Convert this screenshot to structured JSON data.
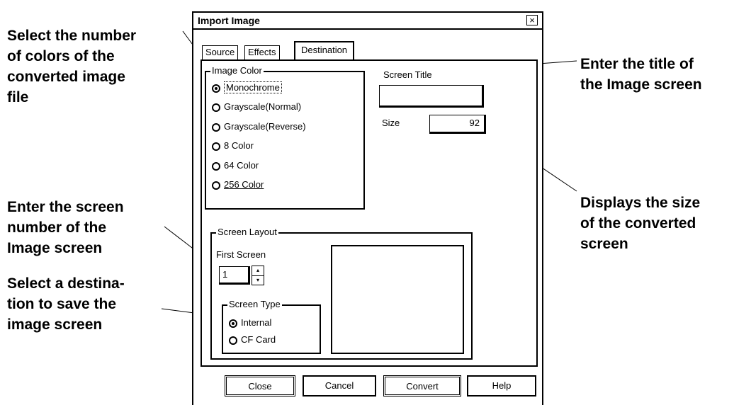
{
  "callouts": {
    "colors": [
      "Select the number",
      "of colors of the",
      "converted image",
      "file"
    ],
    "title": [
      "Enter the title of",
      "the Image screen"
    ],
    "screen_number": [
      "Enter the screen",
      "number of the",
      "Image screen"
    ],
    "destination": [
      "Select a destina-",
      "tion to save the",
      "image screen"
    ],
    "size": [
      "Displays the size",
      "of the converted",
      "screen"
    ]
  },
  "dialog": {
    "title": "Import Image",
    "close_symbol": "×",
    "tabs": [
      "Source",
      "Effects",
      "Destination"
    ],
    "image_color": {
      "label": "Image Color",
      "options": [
        "Monochrome",
        "Grayscale(Normal)",
        "Grayscale(Reverse)",
        "8 Color",
        "64 Color",
        "256 Color"
      ],
      "selected": "Monochrome"
    },
    "screen_title_label": "Screen Title",
    "screen_title_value": "",
    "size_label": "Size",
    "size_value": "92",
    "screen_layout": {
      "label": "Screen Layout",
      "first_screen_label": "First Screen",
      "first_screen_value": "1",
      "screen_type": {
        "label": "Screen Type",
        "options": [
          "Internal",
          "CF Card"
        ],
        "selected": "Internal"
      }
    },
    "buttons": [
      "Close",
      "Cancel",
      "Convert",
      "Help"
    ]
  }
}
